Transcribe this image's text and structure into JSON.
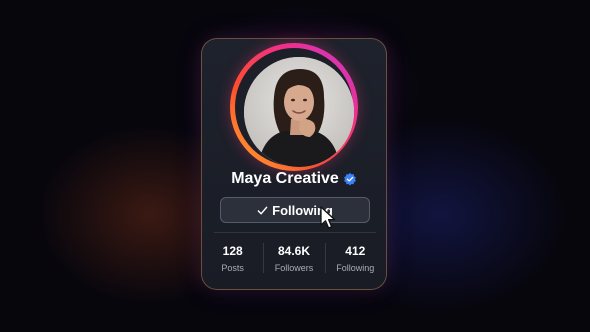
{
  "profile": {
    "name": "Maya Creative",
    "verified": true,
    "verified_color": "#3b82f6",
    "story_ring_colors": [
      "#ffb02e",
      "#ff4d2e",
      "#f02f8a",
      "#c13bd6"
    ]
  },
  "follow_button": {
    "label": "Following",
    "icon": "check-icon"
  },
  "stats": {
    "posts": {
      "value": "128",
      "label": "Posts"
    },
    "followers": {
      "value": "84.6K",
      "label": "Followers"
    },
    "following": {
      "value": "412",
      "label": "Following"
    }
  },
  "cursor": {
    "icon": "pointer-hand-icon"
  }
}
